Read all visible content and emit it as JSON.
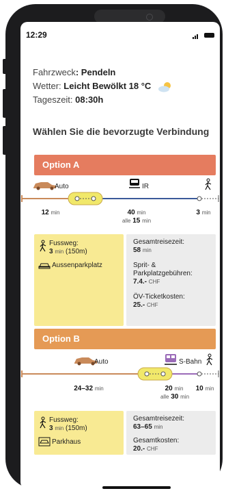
{
  "status": {
    "time": "12:29"
  },
  "info": {
    "purpose_label": "Fahrzweck",
    "purpose_value": ": Pendeln",
    "weather_label": "Wetter: ",
    "weather_value": "Leicht Bewölkt 18 °C",
    "daytime_label": "Tageszeit: ",
    "daytime_value": "08:30h"
  },
  "heading": "Wählen Sie die bevorzugte Verbindung",
  "options": [
    {
      "title": "Option A",
      "color": "#e57c5f",
      "mode1": "Auto",
      "mode2": "IR",
      "seg1_time": "12",
      "seg2_time": "40",
      "seg2_freq": "15",
      "seg3_time": "3",
      "unit": "min",
      "freq_prefix": "alle",
      "walk_label": "Fussweg:",
      "walk_time": "3",
      "walk_dist": "(150m)",
      "parking": "Aussenparkplatz",
      "total_label": "Gesamtreisezeit:",
      "total_value": "58",
      "cost1_label_a": "Sprit- &",
      "cost1_label_b": "Parkplatzgebühren:",
      "cost1_value": "7.4.-",
      "cost2_label": "ÖV-Ticketkosten:",
      "cost2_value": "25.-",
      "currency": "CHF"
    },
    {
      "title": "Option B",
      "color": "#e59a55",
      "mode1": "Auto",
      "mode2": "S-Bahn",
      "seg1_time": "24–32",
      "seg2_time": "20",
      "seg2_freq": "30",
      "seg3_time": "10",
      "unit": "min",
      "freq_prefix": "alle",
      "walk_label": "Fussweg:",
      "walk_time": "3",
      "walk_dist": "(150m)",
      "parking": "Parkhaus",
      "total_label": "Gesamtreisezeit:",
      "total_value": "63–65",
      "cost_label": "Gesamtkosten:",
      "cost_value": "20.-",
      "currency": "CHF"
    }
  ],
  "colors": {
    "car_line": "#c98a5a",
    "ir_line": "#3a5a9a",
    "sbahn_line": "#9a6ab8",
    "transfer": "#f1e86a",
    "yellow_card": "#f8ea93",
    "grey_card": "#ececec"
  }
}
